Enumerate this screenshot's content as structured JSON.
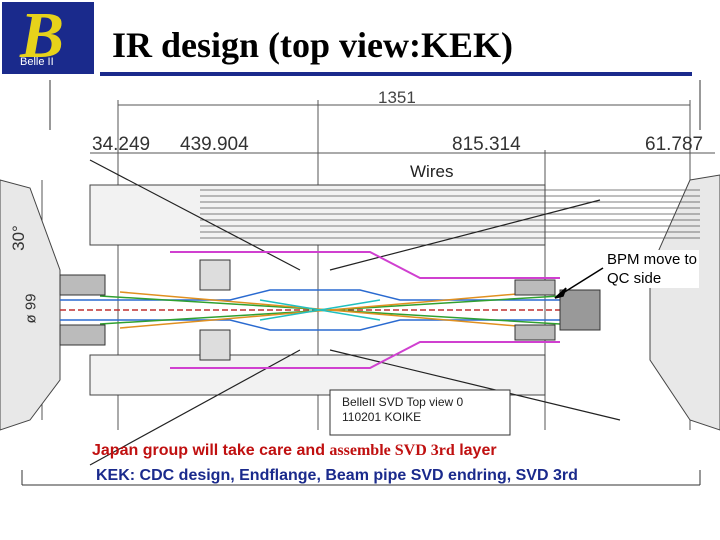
{
  "header": {
    "logo_letter": "B",
    "logo_subtitle": "Belle II",
    "title": "IR design (top view:KEK)"
  },
  "drawing": {
    "dim_total": "1351",
    "dimensions": [
      "34.249",
      "439.904",
      "815.314",
      "61.787"
    ],
    "wires_label": "Wires",
    "angle_label": "30°",
    "diameter_label": "ø 99",
    "bpm_note": [
      "BPM move to",
      "QC side"
    ],
    "title_block": [
      "BelleII SVD Top view 0",
      "110201   KOIKE"
    ]
  },
  "notes": {
    "line1_a": "Japan group will  take care and ",
    "line1_b": "assemble  SVD 3rd",
    "line1_c": " layer",
    "line2": "KEK:  CDC design, Endflange, Beam pipe SVD endring, SVD 3rd"
  },
  "colors": {
    "logo_bg": "#1a2a8c",
    "logo_letter": "#e6d21a",
    "title_bar": "#1a2a8c",
    "note_red": "#c01010",
    "note_blue": "#1a2a8c"
  }
}
